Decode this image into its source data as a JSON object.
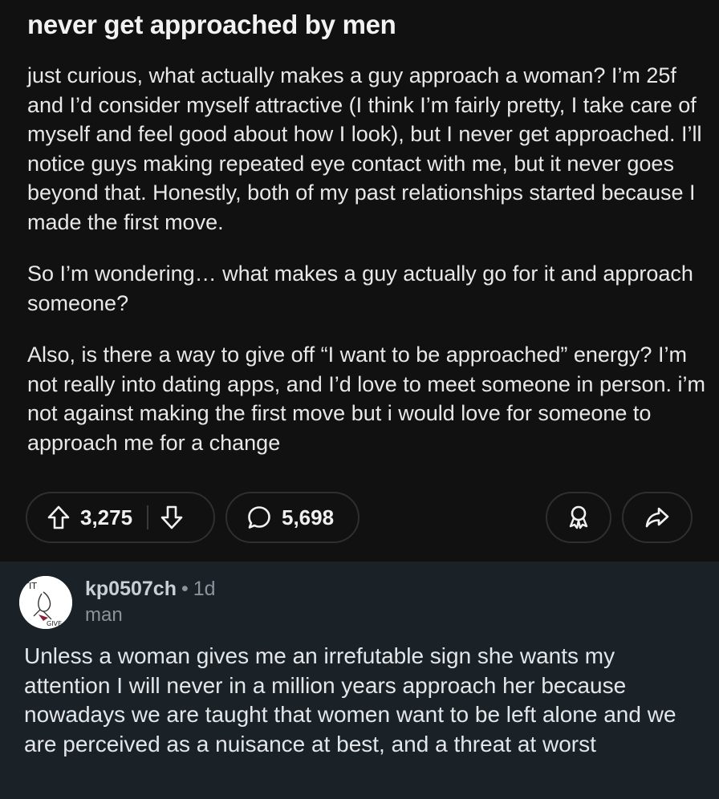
{
  "post": {
    "title": "never get approached by men",
    "paragraphs": [
      "just curious, what actually makes a guy approach a woman? I’m 25f and I’d consider myself attractive (I think I’m fairly pretty, I take care of myself and feel good about how I look), but I never get approached. I’ll notice guys making repeated eye contact with me, but it never goes beyond that. Honestly, both of my past relationships started because I made the first move.",
      "So I’m wondering… what makes a guy actually go for it and approach someone?",
      "Also, is there a way to give off “I want to be approached” energy? I’m not really into dating apps, and I’d love to meet someone in person. i’m not against making the first move but i would love for someone to approach me for a change"
    ],
    "upvotes": "3,275",
    "comments_count": "5,698",
    "icons": {
      "upvote": "upvote-arrow-icon",
      "downvote": "downvote-arrow-icon",
      "comment": "comment-bubble-icon",
      "award": "award-icon",
      "share": "share-arrow-icon"
    }
  },
  "comment": {
    "author": "kp0507ch",
    "separator": "•",
    "time": "1d",
    "flair": "man",
    "body": "Unless a woman gives me an irrefutable sign she wants my attention I will never in a million years approach her because nowadays we are taught that women want to be left alone and we are perceived as a nuisance at best, and a threat at worst",
    "avatar_text_top": "IT",
    "avatar_text_bottom": "GIVE"
  },
  "colors": {
    "post_bg": "#111111",
    "comment_bg": "#1b2227",
    "text": "#e8e8e8",
    "muted": "#8b949a",
    "border": "#2f2f2f"
  }
}
